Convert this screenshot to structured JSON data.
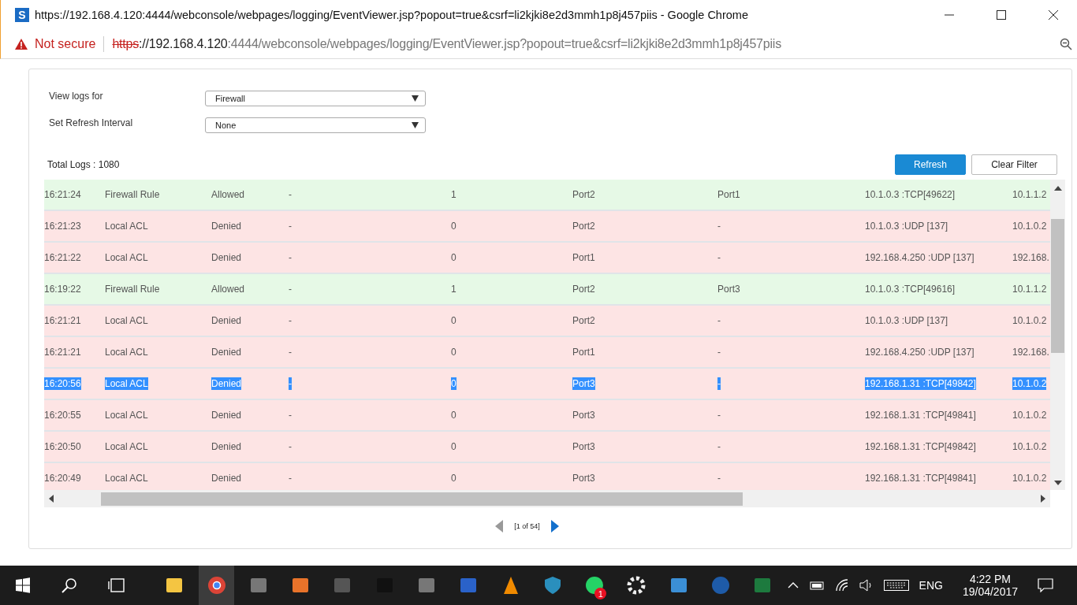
{
  "window": {
    "logo_letter": "S",
    "title": "https://192.168.4.120:4444/webconsole/webpages/logging/EventViewer.jsp?popout=true&csrf=li2kjki8e2d3mmh1p8j457piis - Google Chrome"
  },
  "address_bar": {
    "security": "Not secure",
    "scheme": "https",
    "host": "://192.168.4.120",
    "path": ":4444/webconsole/webpages/logging/EventViewer.jsp?popout=true&csrf=li2kjki8e2d3mmh1p8j457piis"
  },
  "filters": [
    {
      "label": "View logs for",
      "value": "Firewall"
    },
    {
      "label": "Set Refresh Interval",
      "value": "None"
    }
  ],
  "total_logs": "Total Logs : 1080",
  "buttons": [
    {
      "label": "Refresh",
      "kind": "primary"
    },
    {
      "label": "Clear Filter",
      "kind": "secondary"
    }
  ],
  "rows": [
    {
      "cells": [
        "16:21:24",
        "Firewall Rule",
        "Allowed",
        "-",
        "1",
        "Port2",
        "Port1",
        "10.1.0.3 :TCP[49622]",
        "10.1.1.2"
      ],
      "color": "#e6f9e6",
      "selected": false
    },
    {
      "cells": [
        "16:21:23",
        "Local ACL",
        "Denied",
        "-",
        "0",
        "Port2",
        "-",
        "10.1.0.3 :UDP [137]",
        "10.1.0.2"
      ],
      "color": "#fde4e4",
      "selected": false
    },
    {
      "cells": [
        "16:21:22",
        "Local ACL",
        "Denied",
        "-",
        "0",
        "Port1",
        "-",
        "192.168.4.250 :UDP [137]",
        "192.168."
      ],
      "color": "#fde4e4",
      "selected": false
    },
    {
      "cells": [
        "16:19:22",
        "Firewall Rule",
        "Allowed",
        "-",
        "1",
        "Port2",
        "Port3",
        "10.1.0.3 :TCP[49616]",
        "10.1.1.2"
      ],
      "color": "#e6f9e6",
      "selected": false
    },
    {
      "cells": [
        "16:21:21",
        "Local ACL",
        "Denied",
        "-",
        "0",
        "Port2",
        "-",
        "10.1.0.3 :UDP [137]",
        "10.1.0.2"
      ],
      "color": "#fde4e4",
      "selected": false
    },
    {
      "cells": [
        "16:21:21",
        "Local ACL",
        "Denied",
        "-",
        "0",
        "Port1",
        "-",
        "192.168.4.250 :UDP [137]",
        "192.168."
      ],
      "color": "#fde4e4",
      "selected": false
    },
    {
      "cells": [
        "16:20:56",
        "Local ACL",
        "Denied",
        "-",
        "0",
        "Port3",
        "-",
        "192.168.1.31 :TCP[49842]",
        "10.1.0.2"
      ],
      "color": "#fde4e4",
      "selected": true
    },
    {
      "cells": [
        "16:20:55",
        "Local ACL",
        "Denied",
        "-",
        "0",
        "Port3",
        "-",
        "192.168.1.31 :TCP[49841]",
        "10.1.0.2"
      ],
      "color": "#fde4e4",
      "selected": false
    },
    {
      "cells": [
        "16:20:50",
        "Local ACL",
        "Denied",
        "-",
        "0",
        "Port3",
        "-",
        "192.168.1.31 :TCP[49842]",
        "10.1.0.2"
      ],
      "color": "#fde4e4",
      "selected": false
    },
    {
      "cells": [
        "16:20:49",
        "Local ACL",
        "Denied",
        "-",
        "0",
        "Port3",
        "-",
        "192.168.1.31 :TCP[49841]",
        "10.1.0.2"
      ],
      "color": "#fde4e4",
      "selected": false
    }
  ],
  "pagination": {
    "text": "[1 of 54]",
    "prev_disabled": true,
    "next_disabled": false
  },
  "taskbar": {
    "apps": [
      {
        "kind": "folder"
      },
      {
        "kind": "browser",
        "selected": true
      },
      {
        "kind": "editor"
      },
      {
        "kind": "orange"
      },
      {
        "kind": "animal"
      },
      {
        "kind": "terminal"
      },
      {
        "kind": "editor"
      },
      {
        "kind": "network"
      },
      {
        "kind": "cone"
      },
      {
        "kind": "shield"
      },
      {
        "kind": "chat",
        "badge": "1"
      },
      {
        "kind": "gear"
      },
      {
        "kind": "card"
      },
      {
        "kind": "mail"
      },
      {
        "kind": "sheet"
      }
    ],
    "language": "ENG",
    "time": "4:22 PM",
    "date": "19/04/2017"
  }
}
